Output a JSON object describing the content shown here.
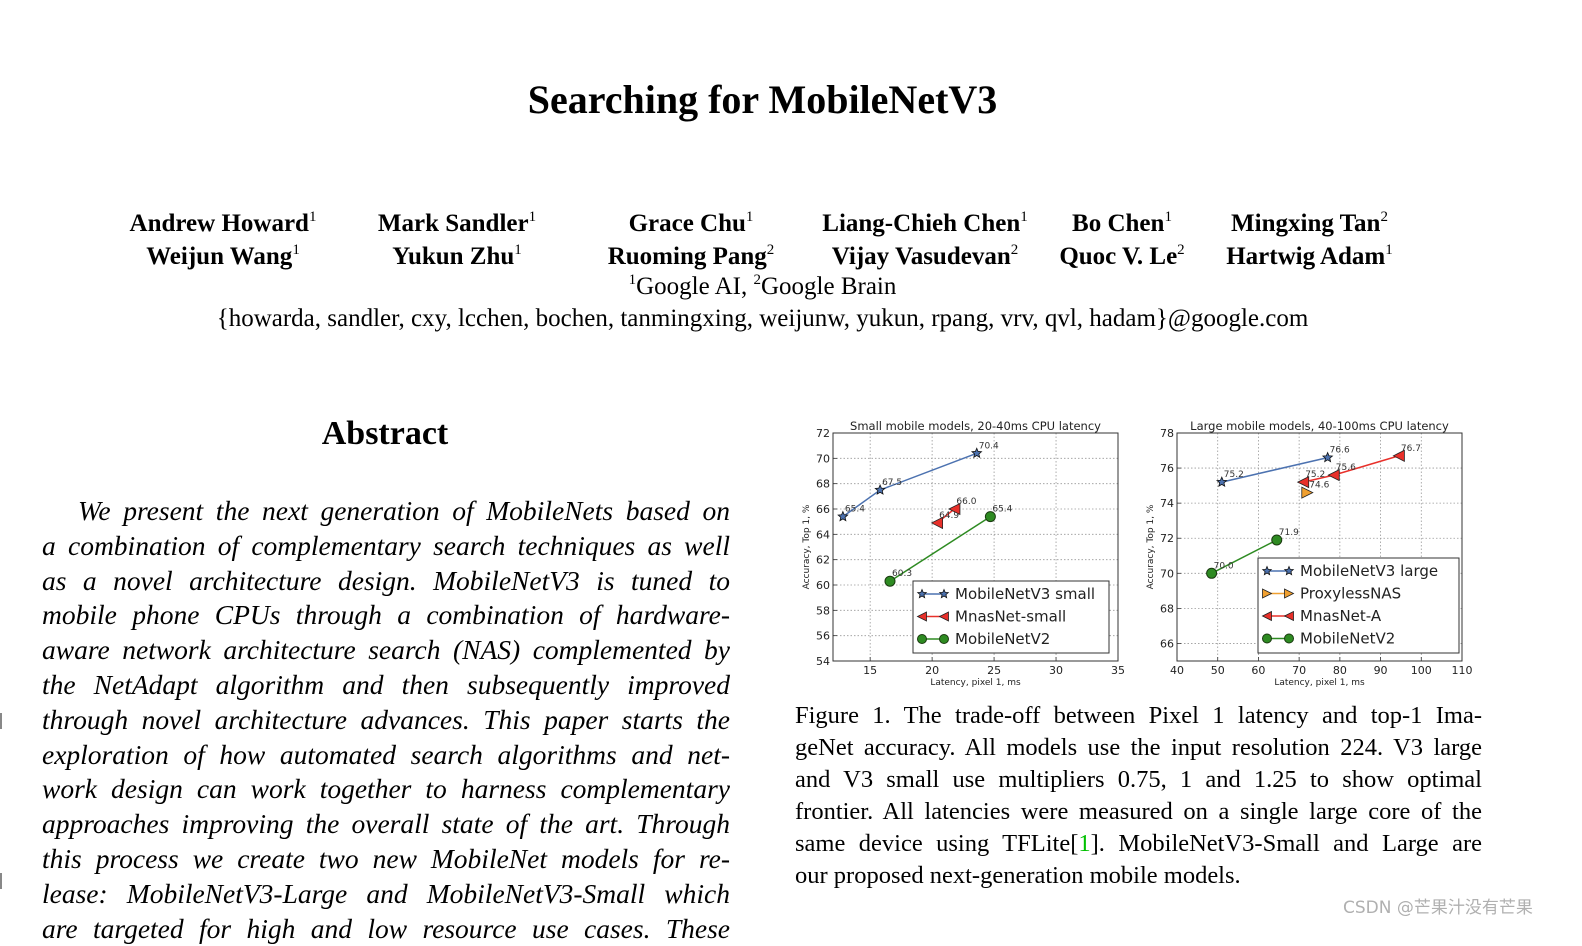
{
  "paper": {
    "title": "Searching for MobileNetV3",
    "authors_row1": [
      {
        "name": "Andrew Howard",
        "sup": "1"
      },
      {
        "name": "Mark Sandler",
        "sup": "1"
      },
      {
        "name": "Grace Chu",
        "sup": "1"
      },
      {
        "name": "Liang-Chieh Chen",
        "sup": "1"
      },
      {
        "name": "Bo Chen",
        "sup": "1"
      },
      {
        "name": "Mingxing Tan",
        "sup": "2"
      }
    ],
    "authors_row2": [
      {
        "name": "Weijun Wang",
        "sup": "1"
      },
      {
        "name": "Yukun Zhu",
        "sup": "1"
      },
      {
        "name": "Ruoming Pang",
        "sup": "2"
      },
      {
        "name": "Vijay Vasudevan",
        "sup": "2"
      },
      {
        "name": "Quoc V. Le",
        "sup": "2"
      },
      {
        "name": "Hartwig Adam",
        "sup": "1"
      }
    ],
    "affiliations": {
      "sup1": "1",
      "aff1": "Google AI, ",
      "sup2": "2",
      "aff2": "Google Brain"
    },
    "emails": "{howarda, sandler, cxy, lcchen, bochen, tanmingxing, weijunw, yukun, rpang, vrv, qvl, hadam}@google.com",
    "abstract": {
      "heading": "Abstract",
      "lines": [
        "We present the next generation of MobileNets based on",
        "a combination of complementary search techniques as well",
        "as a novel architecture design.  MobileNetV3 is tuned to",
        "mobile phone CPUs through a combination of hardware-",
        "aware network architecture search (NAS) complemented by",
        "the NetAdapt algorithm and then subsequently improved",
        "through novel architecture advances. This paper starts the",
        "exploration of how automated search algorithms and net-",
        "work design can work together to harness complementary",
        "approaches improving the overall state of the art. Through",
        "this process we create two new MobileNet models for re-",
        "lease:  MobileNetV3-Large and MobileNetV3-Small which",
        "are targeted for high and low resource use cases. These"
      ]
    },
    "caption": {
      "lines": [
        "Figure 1. The trade-off between Pixel 1 latency and top-1 Ima-",
        "geNet accuracy. All models use the input resolution 224. V3 large",
        "and V3 small use multipliers 0.75, 1 and 1.25 to show optimal",
        "frontier. All latencies were measured on a single large core of the"
      ],
      "line5_pre": "same device using TFLite[",
      "line5_cite": "1",
      "line5_post": "]. MobileNetV3-Small and Large are",
      "line6": "our proposed next-generation mobile models.",
      "cite_color": "#00c000"
    },
    "watermark": "CSDN @芒果汁没有芒果"
  },
  "chart_data": [
    {
      "type": "line",
      "title": "Small mobile models, 20-40ms CPU latency",
      "xlabel": "Latency, pixel 1, ms",
      "ylabel": "Accuracy, Top 1, %",
      "xlim": [
        12,
        35
      ],
      "ylim": [
        54,
        72
      ],
      "xticks": [
        15,
        20,
        25,
        30,
        35
      ],
      "yticks": [
        54,
        56,
        58,
        60,
        62,
        64,
        66,
        68,
        70,
        72
      ],
      "grid": true,
      "legend": "bottom-right",
      "series": [
        {
          "name": "MobileNetV3 small",
          "marker": "star",
          "color": "#4c72b0",
          "x": [
            12.8,
            15.8,
            23.6
          ],
          "y": [
            65.4,
            67.5,
            70.4
          ],
          "labels": [
            "65.4",
            "67.5",
            "70.4"
          ]
        },
        {
          "name": "MnasNet-small",
          "marker": "triangle-left",
          "color": "#e8302a",
          "x": [
            20.4,
            21.8
          ],
          "y": [
            64.9,
            66.0
          ],
          "labels": [
            "64.9",
            "66.0"
          ]
        },
        {
          "name": "MobileNetV2",
          "marker": "circle",
          "color": "#2e8b22",
          "x": [
            16.6,
            24.7
          ],
          "y": [
            60.3,
            65.4
          ],
          "labels": [
            "60.3",
            "65.4"
          ]
        }
      ]
    },
    {
      "type": "line",
      "title": "Large mobile models, 40-100ms CPU latency",
      "xlabel": "Latency, pixel 1, ms",
      "ylabel": "Accuracy, Top 1, %",
      "xlim": [
        40,
        110
      ],
      "ylim": [
        65,
        78
      ],
      "xticks": [
        40,
        50,
        60,
        70,
        80,
        90,
        100,
        110
      ],
      "yticks": [
        66,
        68,
        70,
        72,
        74,
        76,
        78
      ],
      "grid": true,
      "legend": "bottom-right",
      "series": [
        {
          "name": "MobileNetV3 large",
          "marker": "star",
          "color": "#4c72b0",
          "x": [
            51,
            77
          ],
          "y": [
            75.2,
            76.6
          ],
          "labels": [
            "75.2",
            "76.6"
          ]
        },
        {
          "name": "ProxylessNAS",
          "marker": "triangle-right",
          "color": "#f0a030",
          "x": [
            72
          ],
          "y": [
            74.6
          ],
          "labels": [
            "74.6"
          ]
        },
        {
          "name": "MnasNet-A",
          "marker": "triangle-left",
          "color": "#e8302a",
          "x": [
            71,
            78.5,
            94.5
          ],
          "y": [
            75.2,
            75.6,
            76.7
          ],
          "labels": [
            "75.2",
            "75.6",
            "76.7"
          ]
        },
        {
          "name": "MobileNetV2",
          "marker": "circle",
          "color": "#2e8b22",
          "x": [
            48.5,
            64.5
          ],
          "y": [
            70.0,
            71.9
          ],
          "labels": [
            "70.0",
            "71.9"
          ]
        }
      ]
    }
  ]
}
